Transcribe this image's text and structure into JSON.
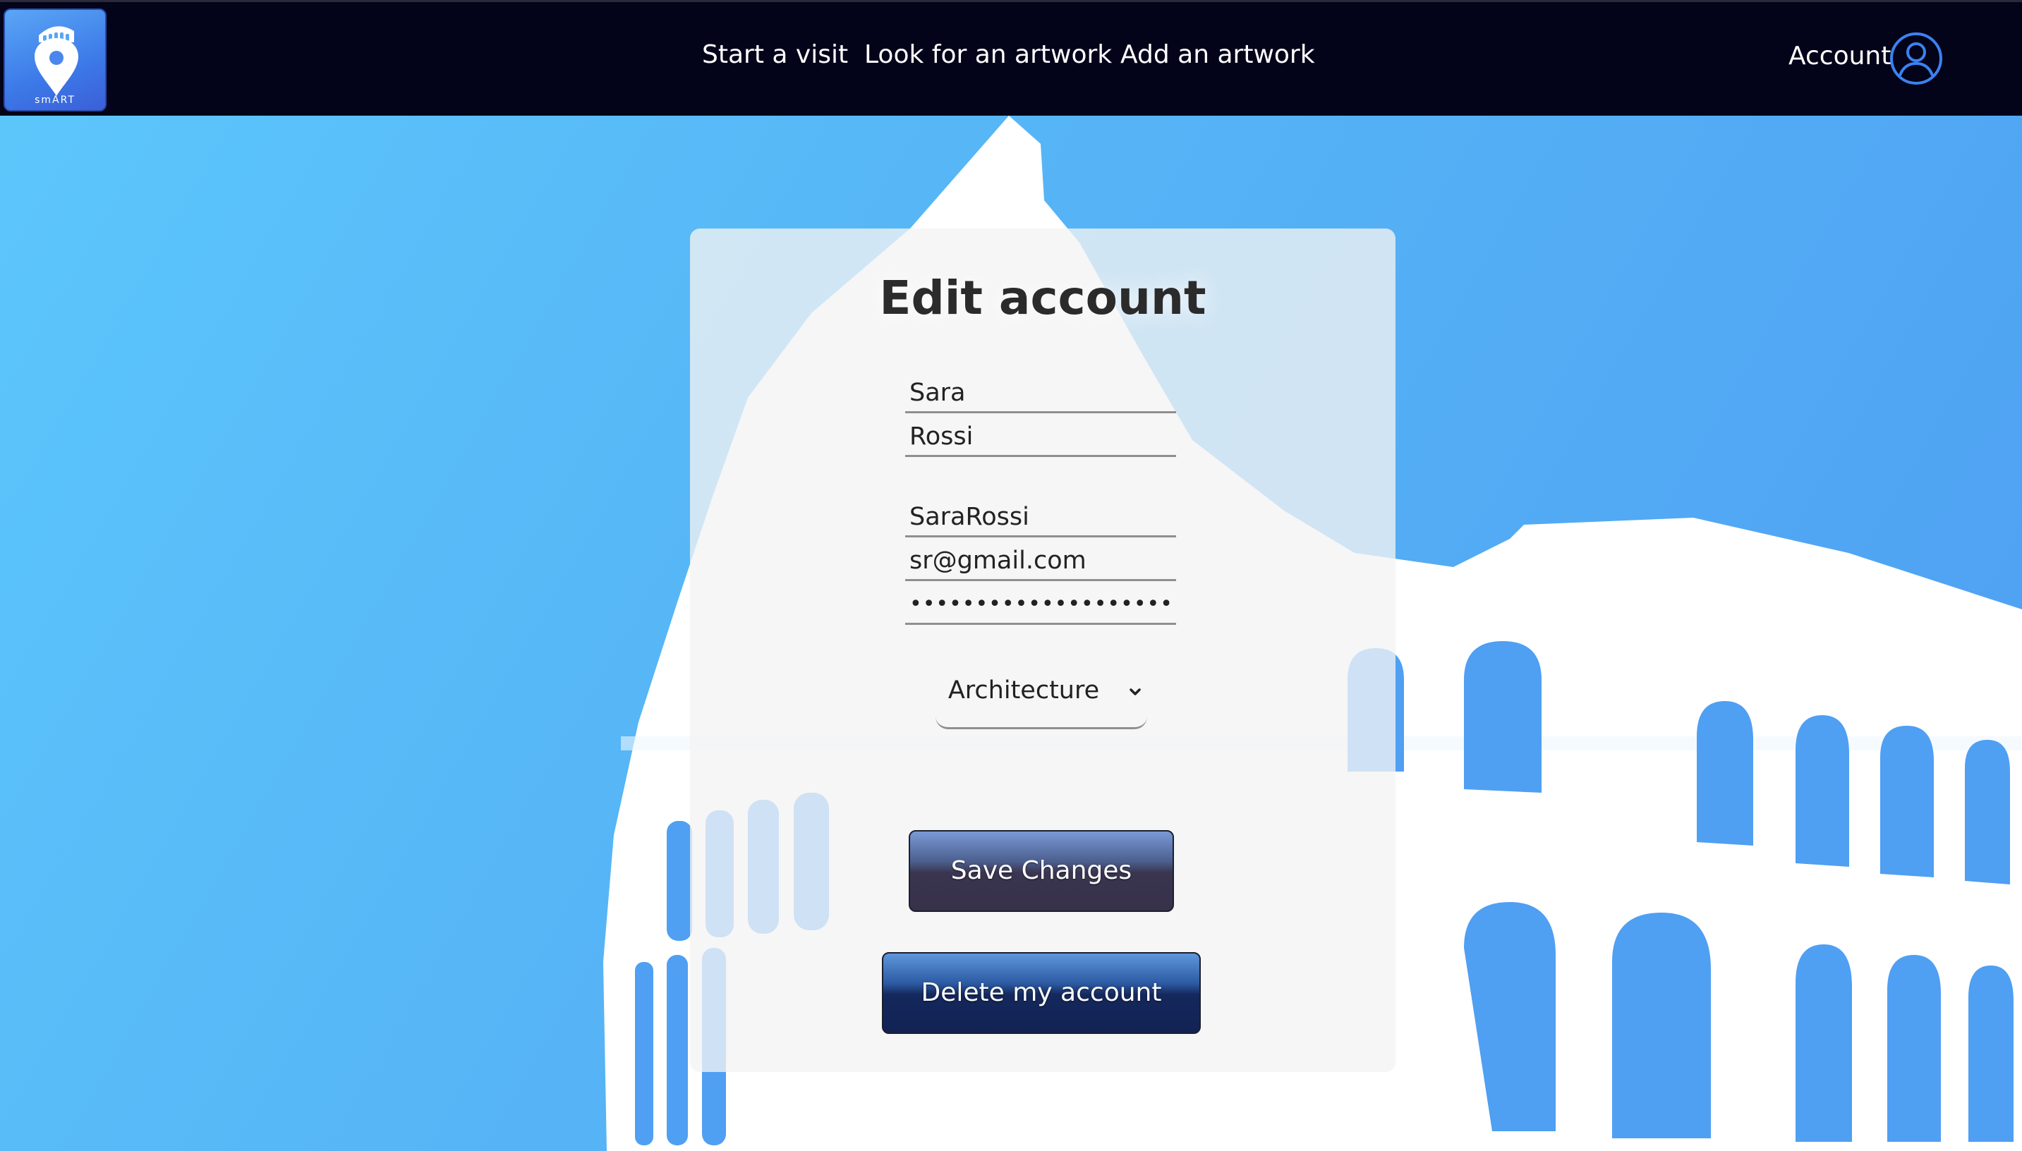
{
  "app": {
    "logo_text": "smART"
  },
  "nav": {
    "links": [
      "Start a visit",
      "Look for an artwork",
      "Add an artwork"
    ],
    "account_label": "Account"
  },
  "form": {
    "title": "Edit account",
    "first_name": "Sara",
    "last_name": "Rossi",
    "username": "SaraRossi",
    "email": "sr@gmail.com",
    "password_mask": "••••••••••••••••••••",
    "interest_selected": "Architecture",
    "save_label": "Save Changes",
    "delete_label": "Delete my account"
  },
  "colors": {
    "navbar_bg": "#03031a",
    "hero_bg": "#54b4f5",
    "save_button": "#37314a",
    "delete_button": "#122254"
  },
  "icons": [
    "pin-icon",
    "user-circle-icon",
    "chevron-down-icon"
  ]
}
